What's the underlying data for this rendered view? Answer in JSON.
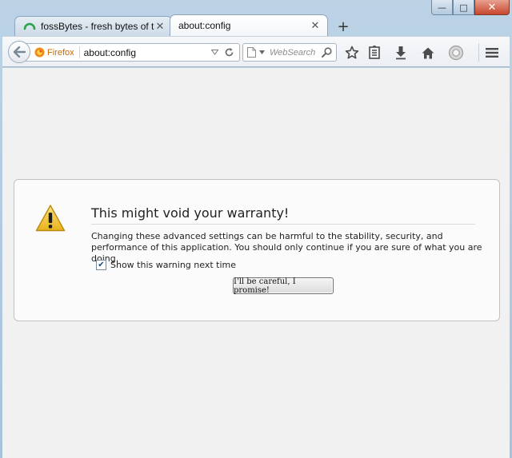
{
  "window": {
    "minimize_label": "—",
    "maximize_label": "□",
    "close_label": "✕"
  },
  "tabs": [
    {
      "title": "fossBytes - fresh bytes of t...",
      "close": "✕",
      "active": false
    },
    {
      "title": "about:config",
      "close": "✕",
      "active": true
    }
  ],
  "new_tab_label": "+",
  "toolbar": {
    "identity_label": "Firefox",
    "url": "about:config",
    "search_placeholder": "WebSearch"
  },
  "warning": {
    "title": "This might void your warranty!",
    "description": "Changing these advanced settings can be harmful to the stability, security, and performance of this application. You should only continue if you are sure of what you are doing.",
    "checkbox_label": "Show this warning next time",
    "checkbox_checked": true,
    "button_label": "I'll be careful, I promise!"
  },
  "colors": {
    "frame": "#a7c2da",
    "content_bg": "#f1f1f1",
    "warning_icon": "#f2c12e",
    "firefox_identity": "#c76a00"
  }
}
